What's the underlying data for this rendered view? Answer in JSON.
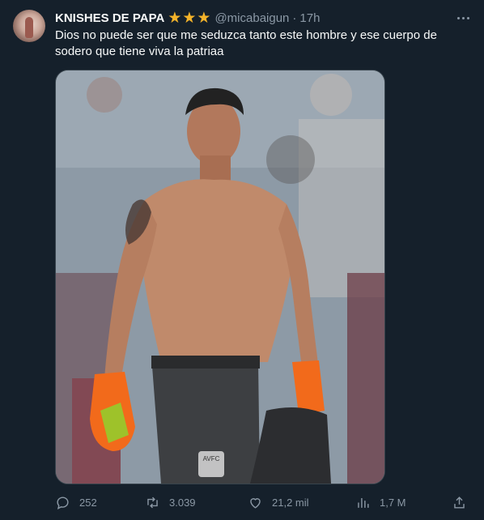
{
  "tweet": {
    "display_name": "KNISHES DE PAPA",
    "stars": [
      "★",
      "★",
      "★"
    ],
    "handle": "@micabaigun",
    "separator": "·",
    "time": "17h",
    "text": "Dios no puede ser que me seduzca tanto este hombre y ese cuerpo de sodero que tiene viva la patriaa"
  },
  "media": {
    "crest_text": "AVFC"
  },
  "actions": {
    "replies": "252",
    "retweets": "3.039",
    "likes": "21,2 mil",
    "views": "1,7 M"
  },
  "icons": [
    "avatar",
    "star-icon",
    "more-icon",
    "reply-icon",
    "retweet-icon",
    "like-icon",
    "views-icon",
    "share-icon"
  ],
  "colors": {
    "background": "#15202b",
    "text": "#f7f9f9",
    "muted": "#8b98a5",
    "star": "#f4b32a",
    "border": "#38444d"
  }
}
